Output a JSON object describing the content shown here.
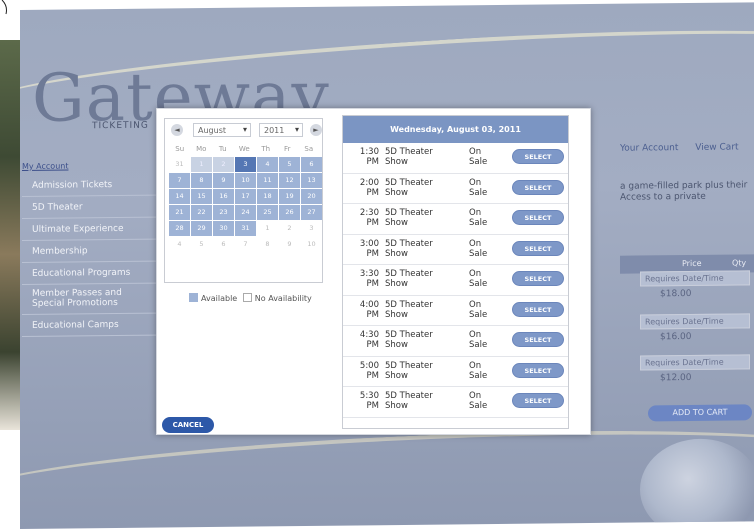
{
  "site": {
    "logo": "Gateway",
    "logo_sub": "TICKETING",
    "account_link": "My Account",
    "nav": [
      "Admission Tickets",
      "5D Theater",
      "Ultimate Experience",
      "Membership",
      "Educational Programs",
      "Member Passes and Special Promotions",
      "Educational Camps"
    ],
    "top_links": [
      "Your Account",
      "View Cart"
    ],
    "side_text": "a game-filled park plus their Access to a private",
    "table_headers": [
      "Price",
      "Qty"
    ],
    "price_boxes": [
      "Requires Date/Time",
      "Requires Date/Time",
      "Requires Date/Time"
    ],
    "prices": [
      "$18.00",
      "$16.00",
      "$12.00"
    ],
    "add_button": "ADD TO CART"
  },
  "calendar": {
    "prev": "◄",
    "next": "►",
    "month": "August",
    "year": "2011",
    "weekdays": [
      "Su",
      "Mo",
      "Tu",
      "We",
      "Th",
      "Fr",
      "Sa"
    ],
    "days": [
      {
        "d": "31",
        "s": "other"
      },
      {
        "d": "1",
        "s": "dim"
      },
      {
        "d": "2",
        "s": "dim"
      },
      {
        "d": "3",
        "s": "today"
      },
      {
        "d": "4",
        "s": "av"
      },
      {
        "d": "5",
        "s": "av"
      },
      {
        "d": "6",
        "s": "av"
      },
      {
        "d": "7",
        "s": "av"
      },
      {
        "d": "8",
        "s": "av"
      },
      {
        "d": "9",
        "s": "av"
      },
      {
        "d": "10",
        "s": "av"
      },
      {
        "d": "11",
        "s": "av"
      },
      {
        "d": "12",
        "s": "av"
      },
      {
        "d": "13",
        "s": "av"
      },
      {
        "d": "14",
        "s": "av"
      },
      {
        "d": "15",
        "s": "av"
      },
      {
        "d": "16",
        "s": "av"
      },
      {
        "d": "17",
        "s": "av"
      },
      {
        "d": "18",
        "s": "av"
      },
      {
        "d": "19",
        "s": "av"
      },
      {
        "d": "20",
        "s": "av"
      },
      {
        "d": "21",
        "s": "av"
      },
      {
        "d": "22",
        "s": "av"
      },
      {
        "d": "23",
        "s": "av"
      },
      {
        "d": "24",
        "s": "av"
      },
      {
        "d": "25",
        "s": "av"
      },
      {
        "d": "26",
        "s": "av"
      },
      {
        "d": "27",
        "s": "av"
      },
      {
        "d": "28",
        "s": "av"
      },
      {
        "d": "29",
        "s": "av"
      },
      {
        "d": "30",
        "s": "av"
      },
      {
        "d": "31",
        "s": "av"
      },
      {
        "d": "1",
        "s": "other"
      },
      {
        "d": "2",
        "s": "other"
      },
      {
        "d": "3",
        "s": "other"
      },
      {
        "d": "4",
        "s": "other"
      },
      {
        "d": "5",
        "s": "other"
      },
      {
        "d": "6",
        "s": "other"
      },
      {
        "d": "7",
        "s": "other"
      },
      {
        "d": "8",
        "s": "other"
      },
      {
        "d": "9",
        "s": "other"
      },
      {
        "d": "10",
        "s": "other"
      }
    ],
    "legend_available": "Available",
    "legend_none": "No Availability"
  },
  "schedule": {
    "title": "Wednesday, August 03, 2011",
    "rows": [
      {
        "time": "1:30 PM",
        "name": "5D Theater Show",
        "status": "On Sale",
        "button": "SELECT"
      },
      {
        "time": "2:00 PM",
        "name": "5D Theater Show",
        "status": "On Sale",
        "button": "SELECT"
      },
      {
        "time": "2:30 PM",
        "name": "5D Theater Show",
        "status": "On Sale",
        "button": "SELECT"
      },
      {
        "time": "3:00 PM",
        "name": "5D Theater Show",
        "status": "On Sale",
        "button": "SELECT"
      },
      {
        "time": "3:30 PM",
        "name": "5D Theater Show",
        "status": "On Sale",
        "button": "SELECT"
      },
      {
        "time": "4:00 PM",
        "name": "5D Theater Show",
        "status": "On Sale",
        "button": "SELECT"
      },
      {
        "time": "4:30 PM",
        "name": "5D Theater Show",
        "status": "On Sale",
        "button": "SELECT"
      },
      {
        "time": "5:00 PM",
        "name": "5D Theater Show",
        "status": "On Sale",
        "button": "SELECT"
      },
      {
        "time": "5:30 PM",
        "name": "5D Theater Show",
        "status": "On Sale",
        "button": "SELECT"
      }
    ]
  },
  "modal": {
    "cancel": "CANCEL"
  },
  "colors": {
    "accent": "#2d58a8",
    "available": "#9eb3d6",
    "selected": "#5577b4",
    "header": "#7b95c3"
  }
}
